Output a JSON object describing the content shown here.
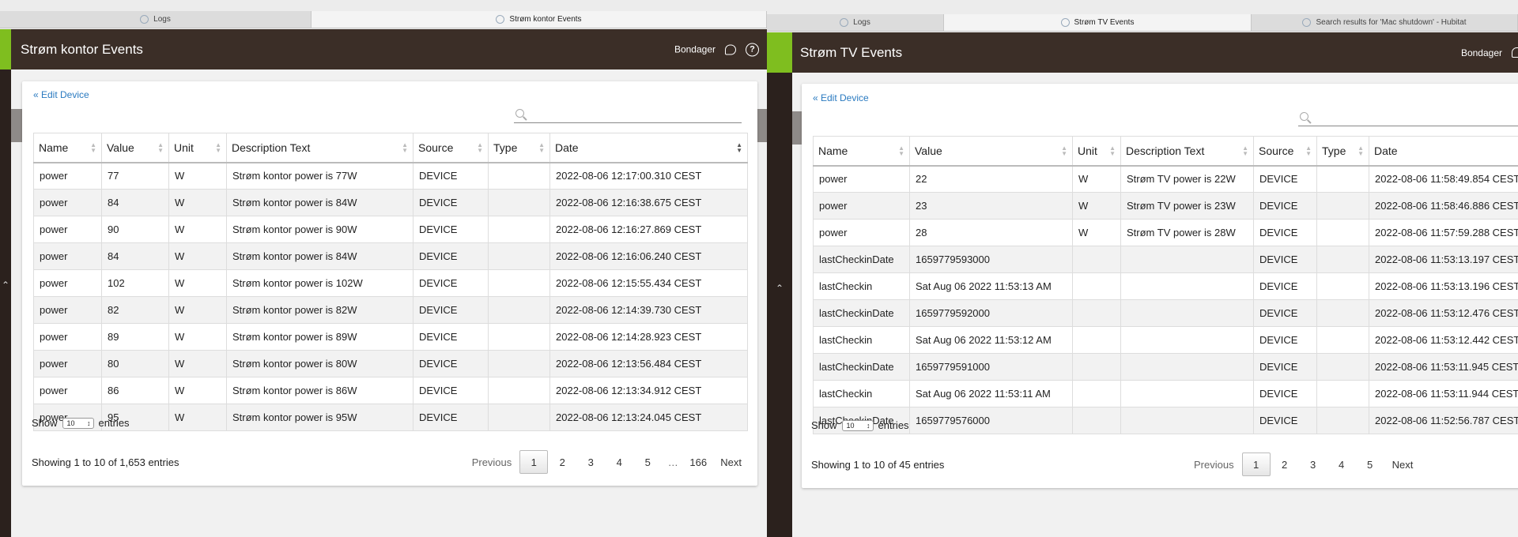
{
  "left": {
    "tabs": [
      {
        "label": "Logs",
        "active": false
      },
      {
        "label": "Strøm kontor Events",
        "active": true
      }
    ],
    "header": {
      "title": "Strøm kontor Events",
      "user": "Bondager",
      "help": "?"
    },
    "edit_link": "« Edit Device",
    "columns": [
      "Name",
      "Value",
      "Unit",
      "Description Text",
      "Source",
      "Type",
      "Date"
    ],
    "rows": [
      [
        "power",
        "77",
        "W",
        "Strøm kontor power is 77W",
        "DEVICE",
        "",
        "2022-08-06 12:17:00.310 CEST"
      ],
      [
        "power",
        "84",
        "W",
        "Strøm kontor power is 84W",
        "DEVICE",
        "",
        "2022-08-06 12:16:38.675 CEST"
      ],
      [
        "power",
        "90",
        "W",
        "Strøm kontor power is 90W",
        "DEVICE",
        "",
        "2022-08-06 12:16:27.869 CEST"
      ],
      [
        "power",
        "84",
        "W",
        "Strøm kontor power is 84W",
        "DEVICE",
        "",
        "2022-08-06 12:16:06.240 CEST"
      ],
      [
        "power",
        "102",
        "W",
        "Strøm kontor power is 102W",
        "DEVICE",
        "",
        "2022-08-06 12:15:55.434 CEST"
      ],
      [
        "power",
        "82",
        "W",
        "Strøm kontor power is 82W",
        "DEVICE",
        "",
        "2022-08-06 12:14:39.730 CEST"
      ],
      [
        "power",
        "89",
        "W",
        "Strøm kontor power is 89W",
        "DEVICE",
        "",
        "2022-08-06 12:14:28.923 CEST"
      ],
      [
        "power",
        "80",
        "W",
        "Strøm kontor power is 80W",
        "DEVICE",
        "",
        "2022-08-06 12:13:56.484 CEST"
      ],
      [
        "power",
        "86",
        "W",
        "Strøm kontor power is 86W",
        "DEVICE",
        "",
        "2022-08-06 12:13:34.912 CEST"
      ],
      [
        "power",
        "95",
        "W",
        "Strøm kontor power is 95W",
        "DEVICE",
        "",
        "2022-08-06 12:13:24.045 CEST"
      ]
    ],
    "show": {
      "prefix": "Show",
      "value": "10",
      "suffix": "entries"
    },
    "info": "Showing 1 to 10 of 1,653 entries",
    "pager": {
      "prev": "Previous",
      "pages": [
        "1",
        "2",
        "3",
        "4",
        "5",
        "…",
        "166"
      ],
      "current": "1",
      "next": "Next"
    }
  },
  "right": {
    "tabs": [
      {
        "label": "Logs",
        "active": false
      },
      {
        "label": "Strøm TV Events",
        "active": true
      },
      {
        "label": "Search results for 'Mac shutdown' - Hubitat",
        "active": false
      }
    ],
    "header": {
      "title": "Strøm TV Events",
      "user": "Bondager"
    },
    "edit_link": "« Edit Device",
    "columns": [
      "Name",
      "Value",
      "Unit",
      "Description Text",
      "Source",
      "Type",
      "Date"
    ],
    "rows": [
      [
        "power",
        "22",
        "W",
        "Strøm TV power is 22W",
        "DEVICE",
        "",
        "2022-08-06 11:58:49.854 CEST"
      ],
      [
        "power",
        "23",
        "W",
        "Strøm TV power is 23W",
        "DEVICE",
        "",
        "2022-08-06 11:58:46.886 CEST"
      ],
      [
        "power",
        "28",
        "W",
        "Strøm TV power is 28W",
        "DEVICE",
        "",
        "2022-08-06 11:57:59.288 CEST"
      ],
      [
        "lastCheckinDate",
        "1659779593000",
        "",
        "",
        "DEVICE",
        "",
        "2022-08-06 11:53:13.197 CEST"
      ],
      [
        "lastCheckin",
        "Sat Aug 06 2022 11:53:13 AM",
        "",
        "",
        "DEVICE",
        "",
        "2022-08-06 11:53:13.196 CEST"
      ],
      [
        "lastCheckinDate",
        "1659779592000",
        "",
        "",
        "DEVICE",
        "",
        "2022-08-06 11:53:12.476 CEST"
      ],
      [
        "lastCheckin",
        "Sat Aug 06 2022 11:53:12 AM",
        "",
        "",
        "DEVICE",
        "",
        "2022-08-06 11:53:12.442 CEST"
      ],
      [
        "lastCheckinDate",
        "1659779591000",
        "",
        "",
        "DEVICE",
        "",
        "2022-08-06 11:53:11.945 CEST"
      ],
      [
        "lastCheckin",
        "Sat Aug 06 2022 11:53:11 AM",
        "",
        "",
        "DEVICE",
        "",
        "2022-08-06 11:53:11.944 CEST"
      ],
      [
        "lastCheckinDate",
        "1659779576000",
        "",
        "",
        "DEVICE",
        "",
        "2022-08-06 11:52:56.787 CEST"
      ]
    ],
    "show": {
      "prefix": "Show",
      "value": "10",
      "suffix": "entries"
    },
    "info": "Showing 1 to 10 of 45 entries",
    "pager": {
      "prev": "Previous",
      "pages": [
        "1",
        "2",
        "3",
        "4",
        "5"
      ],
      "current": "1",
      "next": "Next"
    }
  }
}
